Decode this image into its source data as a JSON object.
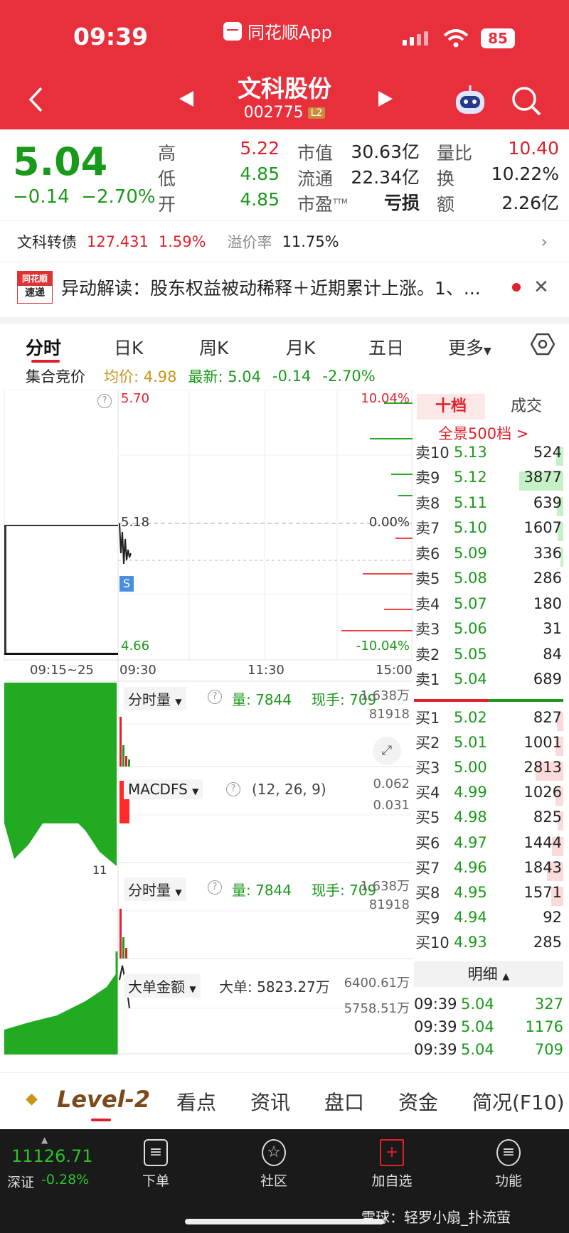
{
  "status_bar": {
    "time": "09:39",
    "app_name": "同花顺App",
    "battery": "85"
  },
  "header": {
    "stock_name": "文科股份",
    "stock_code": "002775",
    "level_badge": "L2"
  },
  "quote": {
    "price": "5.04",
    "change": "−0.14",
    "change_pct": "−2.70%",
    "high_label": "高",
    "high": "5.22",
    "low_label": "低",
    "low": "4.85",
    "open_label": "开",
    "open": "4.85",
    "mcap_label": "市值",
    "mcap": "30.63亿",
    "float_label": "流通",
    "float": "22.34亿",
    "pe_label": "市盈",
    "pe_sup": "TTM",
    "pe": "亏损",
    "vr_label": "量比",
    "vr": "10.40",
    "turnover_label": "换",
    "turnover": "10.22%",
    "amount_label": "额",
    "amount": "2.26亿"
  },
  "convertible": {
    "label": "文科转债",
    "price": "127.431",
    "pct": "1.59%",
    "premium_label": "溢价率",
    "premium": "11.75%"
  },
  "news": {
    "logo_top": "同花顺",
    "logo_bottom": "速递",
    "text": "异动解读：股东权益被动稀释＋近期累计上涨。1、..."
  },
  "tabs": [
    "分时",
    "日K",
    "周K",
    "月K",
    "五日",
    "更多"
  ],
  "infoline": {
    "auction": "集合竞价",
    "avg": "均价: 4.98",
    "latest": "最新: 5.04",
    "chg": "-0.14",
    "pct": "-2.70%"
  },
  "chart": {
    "high_label": "5.70",
    "mid_label": "5.18",
    "low_label": "4.66",
    "up_pct": "10.04%",
    "zero_pct": "0.00%",
    "down_pct": "-10.04%",
    "s_marker": "S",
    "times": [
      "09:15~25",
      "09:30",
      "11:30",
      "15:00"
    ],
    "vol_panel": {
      "name": "分时量",
      "vol": "量: 7844",
      "hand": "现手: 709",
      "max": "1.638万",
      "mid": "81918"
    },
    "macd_panel": {
      "name": "MACDFS",
      "params": "(12, 26, 9)",
      "max": "0.062",
      "mid": "0.031",
      "side": "11"
    },
    "vol_panel2": {
      "name": "分时量",
      "vol": "量: 7844",
      "hand": "现手: 709",
      "max": "1.638万",
      "mid": "81918"
    },
    "big_panel": {
      "name": "大单金额",
      "big": "大单: 5823.27万",
      "max": "6400.61万",
      "mid": "5758.51万"
    },
    "colors": {
      "up": "#e0202a",
      "down": "#1a9a1a"
    }
  },
  "book": {
    "tab_active": "十档",
    "tab_other": "成交",
    "full_link": "全景500档 >",
    "asks": [
      {
        "label": "卖10",
        "price": "5.13",
        "vol": "524",
        "bar": 0.13
      },
      {
        "label": "卖9",
        "price": "5.12",
        "vol": "3877",
        "bar": 0.8
      },
      {
        "label": "卖8",
        "price": "5.11",
        "vol": "639",
        "bar": 0.12
      },
      {
        "label": "卖7",
        "price": "5.10",
        "vol": "1607",
        "bar": 0.1
      },
      {
        "label": "卖6",
        "price": "5.09",
        "vol": "336",
        "bar": 0.05
      },
      {
        "label": "卖5",
        "price": "5.08",
        "vol": "286",
        "bar": 0
      },
      {
        "label": "卖4",
        "price": "5.07",
        "vol": "180",
        "bar": 0
      },
      {
        "label": "卖3",
        "price": "5.06",
        "vol": "31",
        "bar": 0
      },
      {
        "label": "卖2",
        "price": "5.05",
        "vol": "84",
        "bar": 0
      },
      {
        "label": "卖1",
        "price": "5.04",
        "vol": "689",
        "bar": 0
      }
    ],
    "bids": [
      {
        "label": "买1",
        "price": "5.02",
        "vol": "827",
        "bar": 0.12
      },
      {
        "label": "买2",
        "price": "5.01",
        "vol": "1001",
        "bar": 0.14
      },
      {
        "label": "买3",
        "price": "5.00",
        "vol": "2813",
        "bar": 0.5
      },
      {
        "label": "买4",
        "price": "4.99",
        "vol": "1026",
        "bar": 0.14
      },
      {
        "label": "买5",
        "price": "4.98",
        "vol": "825",
        "bar": 0.1
      },
      {
        "label": "买6",
        "price": "4.97",
        "vol": "1444",
        "bar": 0.2
      },
      {
        "label": "买7",
        "price": "4.96",
        "vol": "1843",
        "bar": 0.3
      },
      {
        "label": "买8",
        "price": "4.95",
        "vol": "1571",
        "bar": 0.22
      },
      {
        "label": "买9",
        "price": "4.94",
        "vol": "92",
        "bar": 0
      },
      {
        "label": "买10",
        "price": "4.93",
        "vol": "285",
        "bar": 0
      }
    ],
    "detail_label": "明细",
    "trades": [
      {
        "time": "09:39",
        "price": "5.04",
        "vol": "327"
      },
      {
        "time": "09:39",
        "price": "5.04",
        "vol": "1176"
      },
      {
        "time": "09:39",
        "price": "5.04",
        "vol": "709"
      }
    ]
  },
  "bottom_tabs": [
    "Level-2",
    "看点",
    "资讯",
    "盘口",
    "资金",
    "简况(F10)"
  ],
  "dock": {
    "index_value": "11126.71",
    "index_name": "深证",
    "index_pct": "-0.28%",
    "items": [
      "下单",
      "社区",
      "加自选",
      "功能"
    ],
    "watermark": "雪球：轻罗小扇_扑流萤"
  }
}
